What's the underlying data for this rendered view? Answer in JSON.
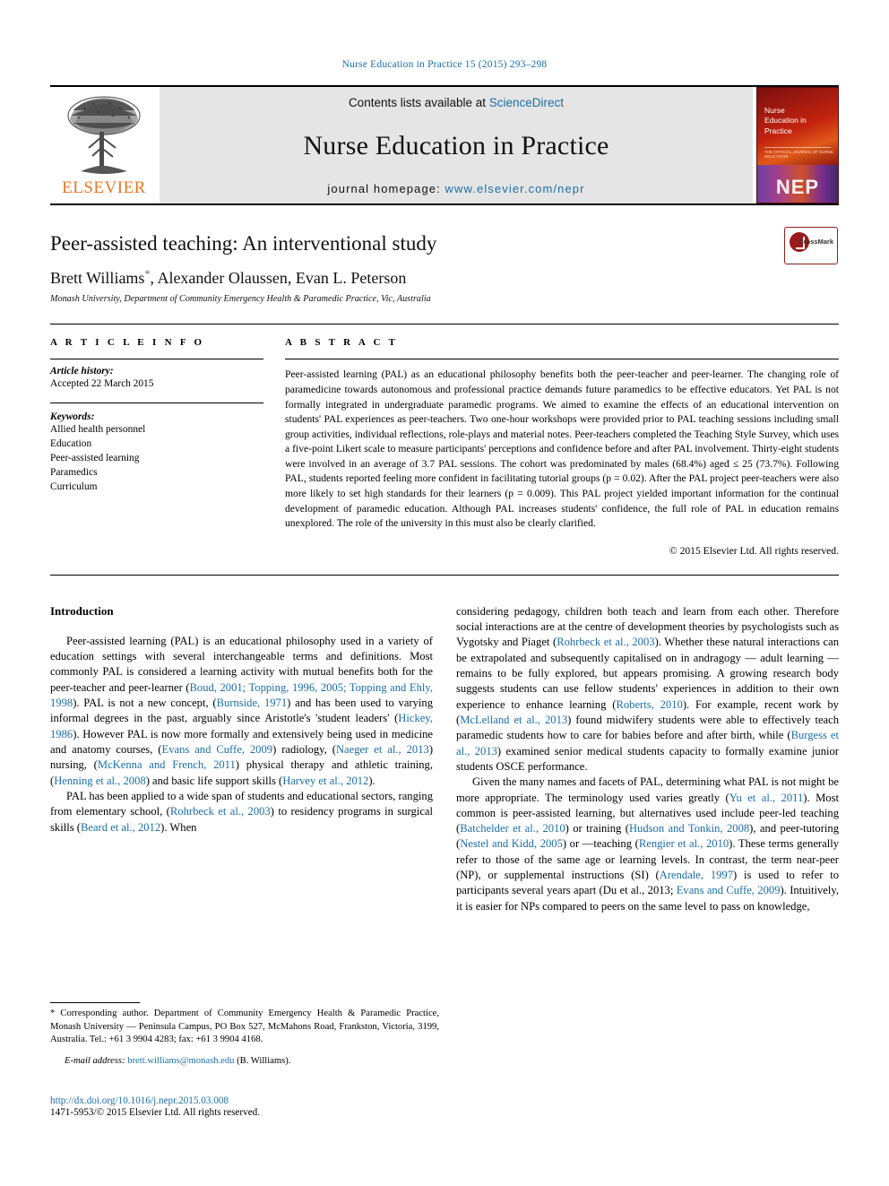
{
  "running_head": "Nurse Education in Practice 15 (2015) 293–298",
  "masthead": {
    "publisher_name": "ELSEVIER",
    "contents_prefix": "Contents lists available at ",
    "contents_link": "ScienceDirect",
    "journal_name": "Nurse Education in Practice",
    "homepage_label": "journal homepage: ",
    "homepage_url": "www.elsevier.com/nepr",
    "cover": {
      "title_lines": [
        "Nurse",
        "Education in",
        "Practice"
      ],
      "subtitle": "THE OFFICIAL JOURNAL OF NURSE EDUCATION",
      "badge": "NEP"
    },
    "link_color": "#1b6ea8"
  },
  "article": {
    "title": "Peer-assisted teaching: An interventional study",
    "authors": "Brett Williams, Alexander Olaussen, Evan L. Peterson",
    "corresponding_marker": "*",
    "affiliation": "Monash University, Department of Community Emergency Health & Paramedic Practice, Vic, Australia",
    "crossmark_label": "CrossMark"
  },
  "article_info": {
    "heading": "A R T I C L E   I N F O",
    "history_label": "Article history:",
    "history_value": "Accepted 22 March 2015",
    "keywords_label": "Keywords:",
    "keywords": [
      "Allied health personnel",
      "Education",
      "Peer-assisted learning",
      "Paramedics",
      "Curriculum"
    ]
  },
  "abstract": {
    "heading": "A B S T R A C T",
    "text": "Peer-assisted learning (PAL) as an educational philosophy benefits both the peer-teacher and peer-learner. The changing role of paramedicine towards autonomous and professional practice demands future paramedics to be effective educators. Yet PAL is not formally integrated in undergraduate paramedic programs. We aimed to examine the effects of an educational intervention on students' PAL experiences as peer-teachers. Two one-hour workshops were provided prior to PAL teaching sessions including small group activities, individual reflections, role-plays and material notes. Peer-teachers completed the Teaching Style Survey, which uses a five-point Likert scale to measure participants' perceptions and confidence before and after PAL involvement. Thirty-eight students were involved in an average of 3.7 PAL sessions. The cohort was predominated by males (68.4%) aged ≤ 25 (73.7%). Following PAL, students reported feeling more confident in facilitating tutorial groups (p = 0.02). After the PAL project peer-teachers were also more likely to set high standards for their learners (p = 0.009). This PAL project yielded important information for the continual development of paramedic education. Although PAL increases students' confidence, the full role of PAL in education remains unexplored. The role of the university in this must also be clearly clarified.",
    "copyright": "© 2015 Elsevier Ltd. All rights reserved."
  },
  "body": {
    "section_heading": "Introduction",
    "left_paragraphs": [
      "Peer-assisted learning (PAL) is an educational philosophy used in a variety of education settings with several interchangeable terms and definitions. Most commonly PAL is considered a learning activity with mutual benefits both for the peer-teacher and peer-learner (Boud, 2001; Topping, 1996, 2005; Topping and Ehly, 1998). PAL is not a new concept, (Burnside, 1971) and has been used to varying informal degrees in the past, arguably since Aristotle's 'student leaders' (Hickey, 1986). However PAL is now more formally and extensively being used in medicine and anatomy courses, (Evans and Cuffe, 2009) radiology, (Naeger et al., 2013) nursing, (McKenna and French, 2011) physical therapy and athletic training, (Henning et al., 2008) and basic life support skills (Harvey et al., 2012).",
      "PAL has been applied to a wide span of students and educational sectors, ranging from elementary school, (Rohrbeck et al., 2003) to residency programs in surgical skills (Beard et al., 2012). When"
    ],
    "right_paragraphs": [
      "considering pedagogy, children both teach and learn from each other. Therefore social interactions are at the centre of development theories by psychologists such as Vygotsky and Piaget (Rohrbeck et al., 2003). Whether these natural interactions can be extrapolated and subsequently capitalised on in andragogy — adult learning — remains to be fully explored, but appears promising. A growing research body suggests students can use fellow students' experiences in addition to their own experience to enhance learning (Roberts, 2010). For example, recent work by (McLelland et al., 2013) found midwifery students were able to effectively teach paramedic students how to care for babies before and after birth, while (Burgess et al., 2013) examined senior medical students capacity to formally examine junior students OSCE performance.",
      "Given the many names and facets of PAL, determining what PAL is not might be more appropriate. The terminology used varies greatly (Yu et al., 2011). Most common is peer-assisted learning, but alternatives used include peer-led teaching (Batchelder et al., 2010) or training (Hudson and Tonkin, 2008), and peer-tutoring (Nestel and Kidd, 2005) or —teaching (Rengier et al., 2010). These terms generally refer to those of the same age or learning levels. In contrast, the term near-peer (NP), or supplemental instructions (SI) (Arendale, 1997) is used to refer to participants several years apart (Du et al., 2013; Evans and Cuffe, 2009). Intuitively, it is easier for NPs compared to peers on the same level to pass on knowledge,"
    ],
    "references_inline": [
      "Boud, 2001; Topping, 1996, 2005; Topping and Ehly, 1998",
      "Burnside, 1971",
      "Hickey, 1986",
      "Evans and Cuffe, 2009",
      "Naeger et al., 2013",
      "McKenna and French, 2011",
      "Henning et al., 2008",
      "Harvey et al., 2012",
      "Rohrbeck et al., 2003",
      "Beard et al., 2012",
      "Roberts, 2010",
      "McLelland et al., 2013",
      "Burgess et al., 2013",
      "Yu et al., 2011",
      "Batchelder et al., 2010",
      "Hudson and Tonkin, 2008",
      "Nestel and Kidd, 2005",
      "Rengier et al., 2010",
      "Arendale, 1997",
      "Du et al., 2013; Evans and Cuffe, 2009"
    ]
  },
  "footnotes": {
    "corresponding": "* Corresponding author. Department of Community Emergency Health & Paramedic Practice, Monash University — Peninsula Campus, PO Box 527, McMahons Road, Frankston, Victoria, 3199, Australia. Tel.: +61 3 9904 4283; fax: +61 3 9904 4168.",
    "email_label": "E-mail address:",
    "email_value": "brett.williams@monash.edu",
    "email_attribution": "(B. Williams)."
  },
  "doi": {
    "url": "http://dx.doi.org/10.1016/j.nepr.2015.03.008",
    "issn_line": "1471-5953/© 2015 Elsevier Ltd. All rights reserved."
  }
}
